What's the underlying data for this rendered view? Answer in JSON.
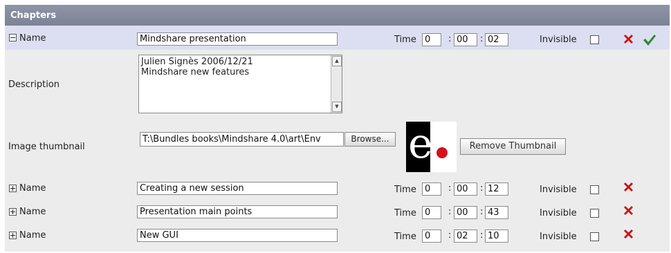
{
  "panel": {
    "title": "Chapters"
  },
  "chapter1": {
    "name_label": "Name",
    "name_value": "Mindshare presentation",
    "time_label": "Time",
    "time_h": "0",
    "time_m": "00",
    "time_s": "02",
    "invisible_label": "Invisible",
    "expander": "minus-box-icon"
  },
  "description": {
    "label": "Description",
    "line1": "Julien Signès 2006/12/21",
    "line2": "Mindshare new features"
  },
  "thumbnail": {
    "label": "Image thumbnail",
    "path_value": "T:\\Bundles books\\Mindshare 4.0\\art\\Env",
    "browse_label": "Browse...",
    "remove_label": "Remove Thumbnail"
  },
  "chapters": [
    {
      "name_label": "Name",
      "name_value": "Creating a new session",
      "time_label": "Time",
      "h": "0",
      "m": "00",
      "s": "12",
      "invisible_label": "Invisible"
    },
    {
      "name_label": "Name",
      "name_value": "Presentation main points",
      "time_label": "Time",
      "h": "0",
      "m": "00",
      "s": "43",
      "invisible_label": "Invisible"
    },
    {
      "name_label": "Name",
      "name_value": "New GUI",
      "time_label": "Time",
      "h": "0",
      "m": "02",
      "s": "10",
      "invisible_label": "Invisible"
    }
  ],
  "colors": {
    "header": "#858b9d",
    "selected_row": "#dcdff1",
    "delete": "#cc1111",
    "ok": "#2a8a2a"
  }
}
